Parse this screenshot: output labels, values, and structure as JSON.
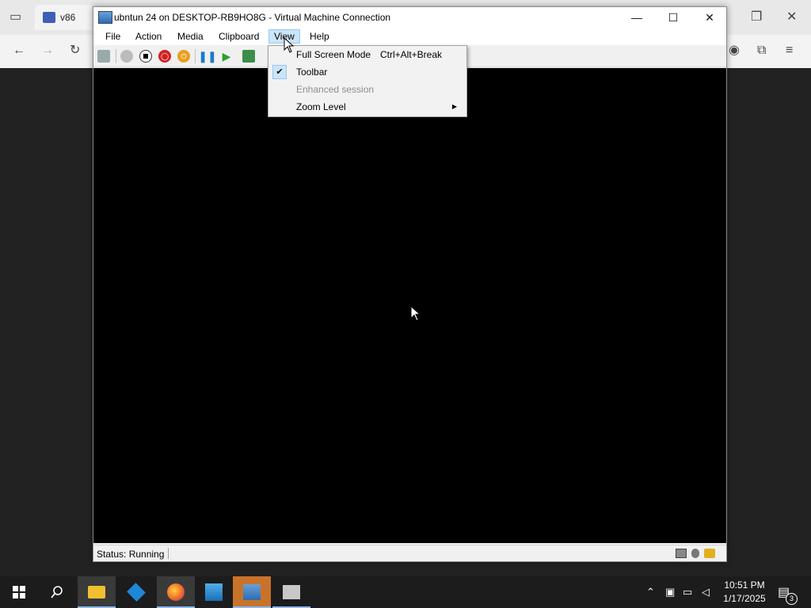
{
  "background_browser": {
    "tab_label": "v86"
  },
  "window": {
    "title": "ubntun 24 on DESKTOP-RB9HO8G - Virtual Machine Connection"
  },
  "menu": {
    "items": [
      {
        "label": "File"
      },
      {
        "label": "Action"
      },
      {
        "label": "Media"
      },
      {
        "label": "Clipboard"
      },
      {
        "label": "View"
      },
      {
        "label": "Help"
      }
    ],
    "open_menu": "View"
  },
  "view_menu": {
    "items": [
      {
        "label": "Full Screen Mode",
        "shortcut": "Ctrl+Alt+Break",
        "checked": false,
        "enabled": true
      },
      {
        "label": "Toolbar",
        "checked": true,
        "enabled": true
      },
      {
        "label": "Enhanced session",
        "checked": false,
        "enabled": false
      },
      {
        "label": "Zoom Level",
        "submenu": true,
        "enabled": true
      }
    ]
  },
  "status": {
    "text": "Status: Running"
  },
  "taskbar": {
    "time": "10:51 PM",
    "date": "1/17/2025",
    "notification_count": "3"
  },
  "colors": {
    "screen": "#000000",
    "menu_highlight": "#cce4f7",
    "taskbar": "#1c1c1c"
  }
}
